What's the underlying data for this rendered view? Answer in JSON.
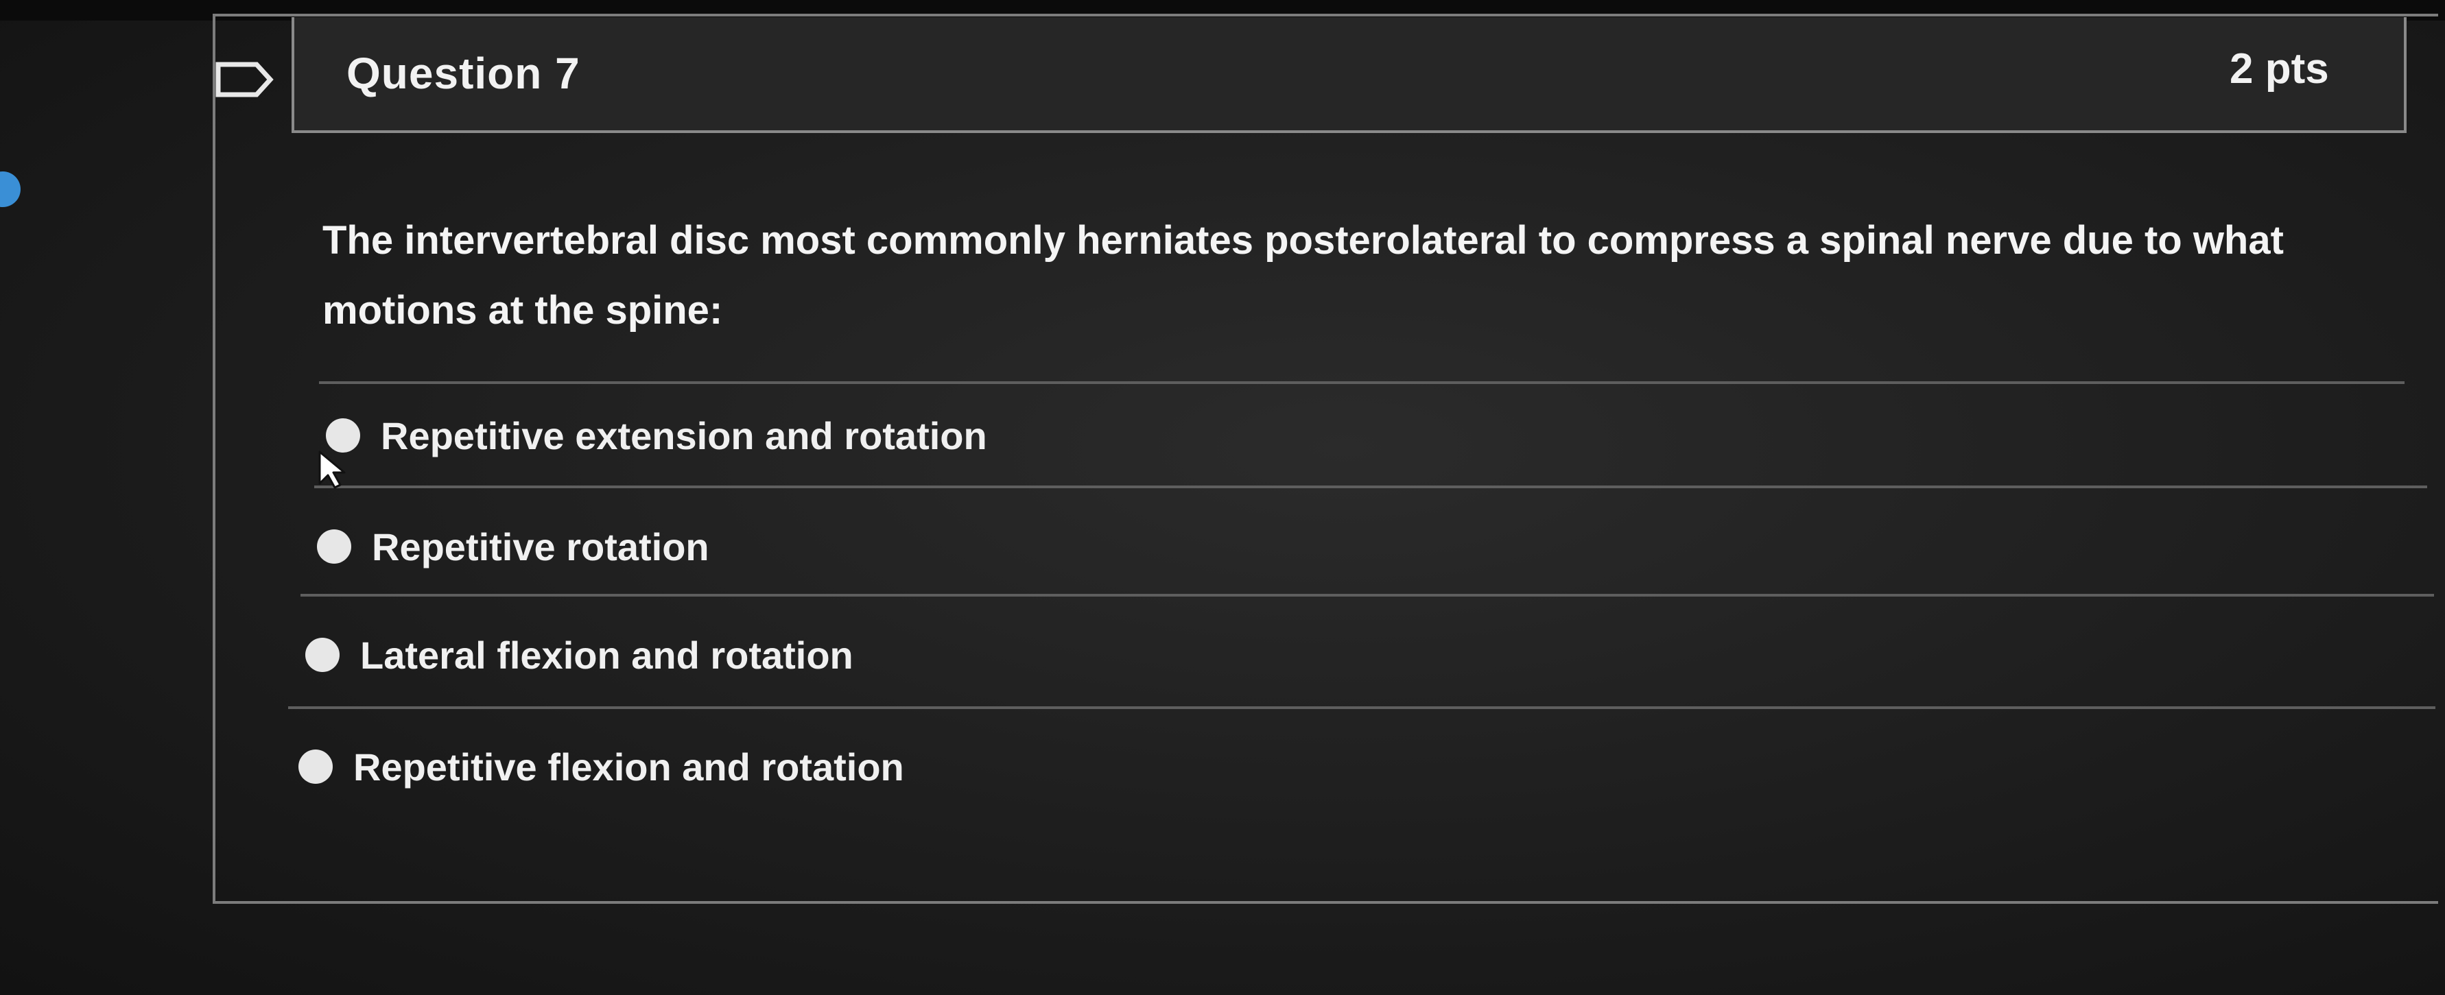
{
  "question": {
    "title": "Question 7",
    "points": "2 pts",
    "text": "The intervertebral disc most commonly herniates posterolateral to compress a spinal nerve due to what motions at the spine:",
    "answers": [
      {
        "label": "Repetitive extension and rotation"
      },
      {
        "label": "Repetitive rotation"
      },
      {
        "label": "Lateral flexion and rotation"
      },
      {
        "label": "Repetitive flexion and rotation"
      }
    ]
  },
  "icons": {
    "flag": "flag-outline-icon",
    "cursor": "mouse-pointer-icon",
    "radio": "radio-unselected-icon"
  },
  "colors": {
    "background": "#1d1d1d",
    "text": "#f2f2f2",
    "border": "#7c7c7c"
  }
}
